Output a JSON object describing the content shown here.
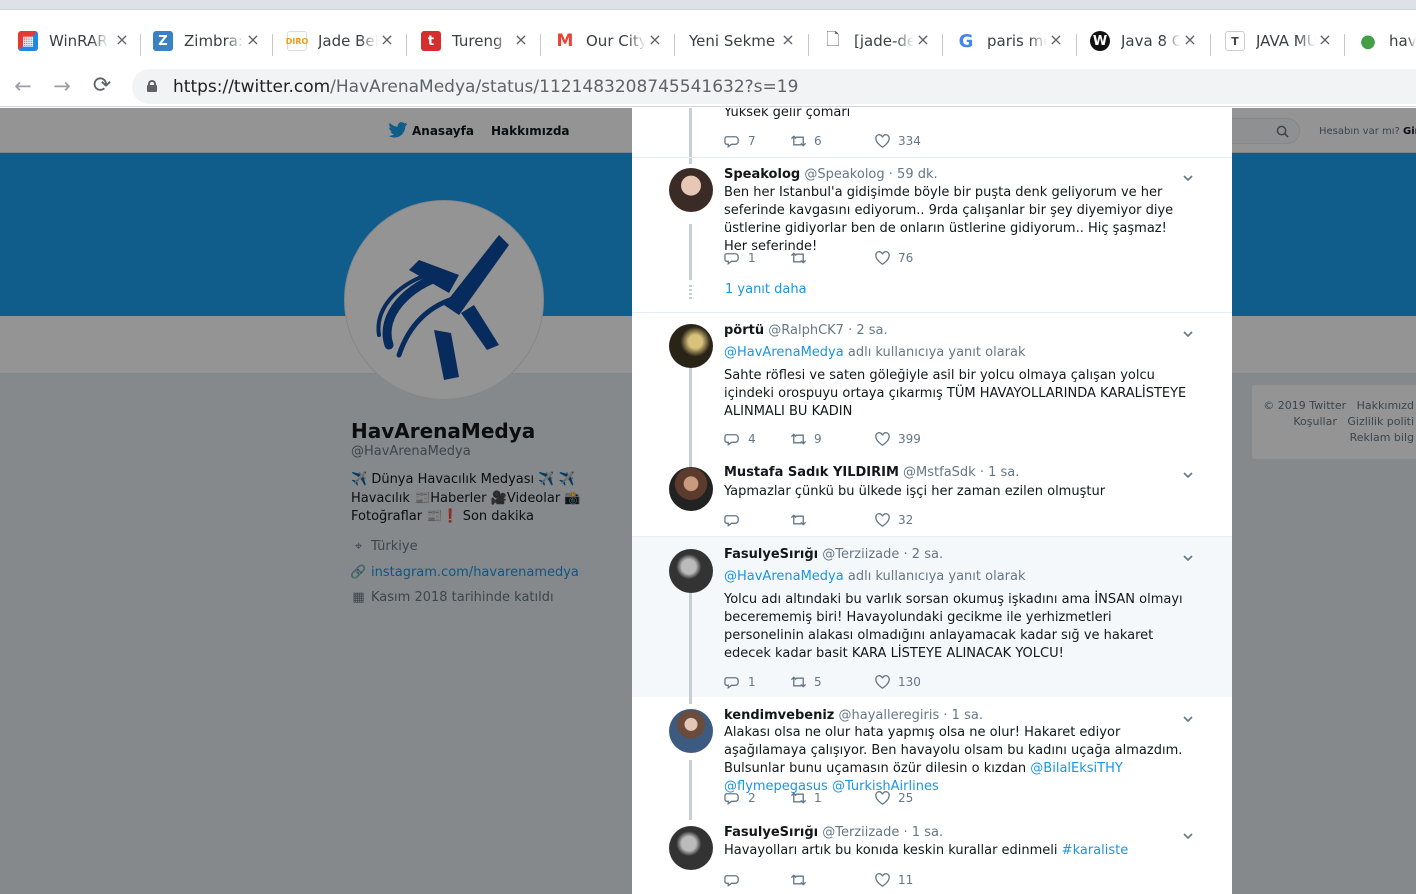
{
  "browser": {
    "tabs": [
      {
        "title": "WinRAR",
        "icon": "winrar-icon",
        "color": "#e53935"
      },
      {
        "title": "Zimbra:",
        "icon": "zimbra-icon",
        "color": "#3b82c4"
      },
      {
        "title": "Jade Bel",
        "icon": "diro-icon",
        "color": "#f39c12"
      },
      {
        "title": "Tureng",
        "icon": "tureng-icon",
        "color": "#d32f2f"
      },
      {
        "title": "Our City",
        "icon": "gmail-icon",
        "color": "#ea4335"
      },
      {
        "title": "Yeni Sekme",
        "icon": "",
        "color": ""
      },
      {
        "title": "[jade-de",
        "icon": "document-icon",
        "color": "#5f6368"
      },
      {
        "title": "paris me",
        "icon": "google-icon",
        "color": "#4285f4"
      },
      {
        "title": "Java 8 C",
        "icon": "w-icon",
        "color": "#111111"
      },
      {
        "title": "JAVA MU",
        "icon": "t-icon",
        "color": "#cccccc"
      },
      {
        "title": "hava",
        "icon": "drop-icon",
        "color": "#43a047"
      }
    ],
    "url_host": "https://twitter.com",
    "url_path": "/HavArenaMedya/status/1121483208745541632?s=19"
  },
  "twitter_nav": {
    "home": "Anasayfa",
    "about": "Hakkımızda",
    "account_prompt": "Hesabın var mı?",
    "login": "Gir"
  },
  "profile": {
    "name": "HavArenaMedya",
    "handle": "@HavArenaMedya",
    "bio": "✈️ Dünya Havacılık Medyası ✈️ ✈️Havacılık 📰Haberler 🎥Videolar 📸Fotoğraflar 📰❗ Son dakika",
    "location": "Türkiye",
    "website": "instagram.com/havarenamedya",
    "joined": "Kasım 2018 tarihinde katıldı"
  },
  "footer": {
    "line1_a": "© 2019 Twitter",
    "line1_b": "Hakkımızd",
    "line2_a": "Koşullar",
    "line2_b": "Gizlilik politi",
    "line3": "Reklam bilg"
  },
  "top_partial": {
    "text": "Yüksek gelir çomarı",
    "replies": "7",
    "retweets": "6",
    "likes": "334"
  },
  "tweets": [
    {
      "name": "Speakolog",
      "handle": "@Speakolog",
      "time": "· 59 dk.",
      "text": "Ben her Istanbul'a gidişimde böyle bir puşta denk geliyorum ve her seferinde kavgasını ediyorum.. 9rda çalışanlar bir şey diyemiyor diye üstlerine gidiyorlar ben de onların üstlerine gidiyorum.. Hiç şaşmaz! Her seferinde!",
      "replies": "1",
      "retweets": "",
      "likes": "76",
      "more": "1 yanıt daha"
    },
    {
      "name": "pörtü",
      "handle": "@RalphCK7",
      "time": "· 2 sa.",
      "reply_mention": "@HavArenaMedya",
      "reply_suffix": "adlı kullanıcıya yanıt olarak",
      "text": "Sahte röflesi ve saten göleğiyle asil bir yolcu olmaya çalışan yolcu içindeki orospuyu ortaya çıkarmış TÜM HAVAYOLLARINDA KARALİSTEYE ALINMALI BU KADIN",
      "replies": "4",
      "retweets": "9",
      "likes": "399"
    },
    {
      "name": "Mustafa Sadık YILDIRIM",
      "handle": "@MstfaSdk",
      "time": "· 1 sa.",
      "text": "Yapmazlar çünkü bu ülkede işçi her zaman ezilen olmuştur",
      "replies": "",
      "retweets": "",
      "likes": "32"
    },
    {
      "name": "FasulyeSırığı",
      "handle": "@Terziizade",
      "time": "· 2 sa.",
      "reply_mention": "@HavArenaMedya",
      "reply_suffix": "adlı kullanıcıya yanıt olarak",
      "text": "Yolcu adı altındaki bu varlık sorsan okumuş işkadını ama İNSAN olmayı becerememiş biri! Havayolundaki gecikme ile yerhizmetleri personelinin alakası olmadığını anlayamacak kadar sığ ve hakaret edecek kadar basit KARA LİSTEYE ALINACAK YOLCU!",
      "replies": "1",
      "retweets": "5",
      "likes": "130"
    },
    {
      "name": "kendimvebeniz",
      "handle": "@hayalleregiris",
      "time": "· 1 sa.",
      "text": "Alakası olsa ne olur hata yapmış olsa ne olur! Hakaret ediyor aşağılamaya çalışıyor. Ben havayolu olsam bu kadını uçağa almazdım. Bulsunlar bunu uçamasın özür dilesin o kızdan",
      "mentions": [
        "@BilalEksiTHY",
        "@flymepegasus",
        "@TurkishAirlines"
      ],
      "replies": "2",
      "retweets": "1",
      "likes": "25"
    },
    {
      "name": "FasulyeSırığı",
      "handle": "@Terziizade",
      "time": "· 1 sa.",
      "text": "Havayolları artık bu konıda keskin kurallar edinmeli",
      "hashtag": "#karaliste",
      "replies": "",
      "retweets": "",
      "likes": "11"
    }
  ],
  "colors": {
    "twitter_blue": "#1da1f2",
    "link_blue": "#1b95e0",
    "muted": "#657786"
  }
}
